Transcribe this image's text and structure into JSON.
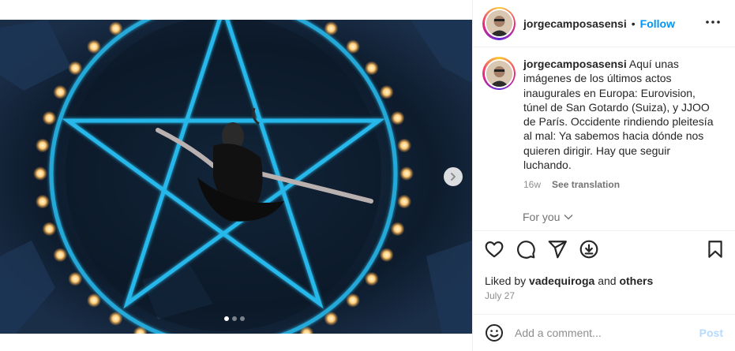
{
  "post": {
    "media": {
      "carousel_count": 3,
      "active_index": 0,
      "next_icon": "chevron-right-icon",
      "description_colors": {
        "glow": "#27b8ea",
        "candle": "#ffcf7a",
        "dark": "#0e1a2a"
      }
    },
    "header": {
      "username": "jorgecamposasensi",
      "separator": "•",
      "follow_label": "Follow",
      "more_icon": "more-horizontal-icon"
    },
    "caption": {
      "username": "jorgecamposasensi",
      "text": "Aquí unas imágenes de los últimos actos inaugurales en Europa: Eurovision, túnel de San Gotardo (Suiza), y JJOO de París. Occidente rindiendo pleitesía al mal: Ya sabemos hacia dónde nos quieren dirigir. Hay que seguir luchando.",
      "age": "16w",
      "see_translation": "See translation"
    },
    "for_you": "For you",
    "likes": {
      "prefix": "Liked by",
      "user": "vadequiroga",
      "middle": "and",
      "others": "others"
    },
    "date": "July 27",
    "comment": {
      "placeholder": "Add a comment...",
      "post_label": "Post"
    }
  },
  "colors": {
    "accent": "#0095f6",
    "post_disabled": "#b3dbff",
    "text": "#262626",
    "secondary": "#8e8e8e"
  }
}
